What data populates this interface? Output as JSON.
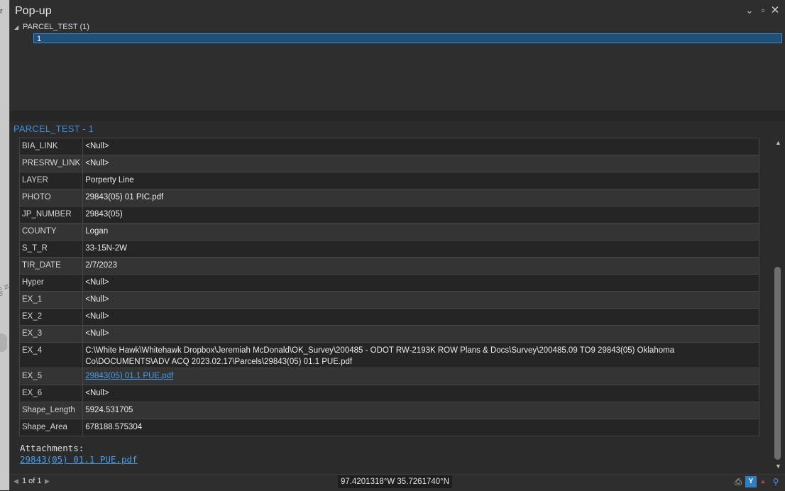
{
  "window": {
    "title": "Pop-up"
  },
  "background": {
    "edge_mark": "r",
    "road_label": "N Blo"
  },
  "tree": {
    "layer_label": "PARCEL_TEST (1)",
    "feature_label": "1"
  },
  "feature": {
    "title": "PARCEL_TEST - 1"
  },
  "attributes": [
    {
      "field": "BIA_LINK",
      "value": "<Null>"
    },
    {
      "field": "PRESRW_LINK",
      "value": "<Null>"
    },
    {
      "field": "LAYER",
      "value": "Porperty Line"
    },
    {
      "field": "PHOTO",
      "value": "29843(05) 01 PIC.pdf"
    },
    {
      "field": "JP_NUMBER",
      "value": "29843(05)"
    },
    {
      "field": "COUNTY",
      "value": "Logan"
    },
    {
      "field": "S_T_R",
      "value": "33-15N-2W"
    },
    {
      "field": "TIR_DATE",
      "value": "2/7/2023"
    },
    {
      "field": "Hyper",
      "value": "<Null>"
    },
    {
      "field": "EX_1",
      "value": "<Null>"
    },
    {
      "field": "EX_2",
      "value": "<Null>"
    },
    {
      "field": "EX_3",
      "value": "<Null>"
    },
    {
      "field": "EX_4",
      "value": "C:\\White Hawk\\Whitehawk Dropbox\\Jeremiah McDonald\\OK_Survey\\200485 - ODOT RW-2193K ROW Plans & Docs\\Survey\\200485.09 TO9 29843(05) Oklahoma Co\\DOCUMENTS\\ADV ACQ 2023.02.17\\Parcels\\29843(05) 01.1 PUE.pdf"
    },
    {
      "field": "EX_5",
      "value": "29843(05) 01.1 PUE.pdf"
    },
    {
      "field": "EX_6",
      "value": "<Null>"
    },
    {
      "field": "Shape_Length",
      "value": "5924.531705"
    },
    {
      "field": "Shape_Area",
      "value": "678188.575304"
    }
  ],
  "attachments": {
    "label": "Attachments:",
    "link": "29843(05) 01.1 PUE.pdf"
  },
  "status": {
    "page": "1 of 1",
    "coordinates": "97.4201318°W 35.7261740°N"
  },
  "icons": {
    "collapse": "chevron-down-icon",
    "maximize": "maximize-icon",
    "close": "close-icon",
    "print": "print-icon",
    "filter": "filter-icon",
    "target": "target-icon",
    "zoom": "zoom-icon"
  },
  "colors": {
    "accent": "#3d8fdc",
    "link": "#4a9de8",
    "selection": "#1f4f78"
  }
}
